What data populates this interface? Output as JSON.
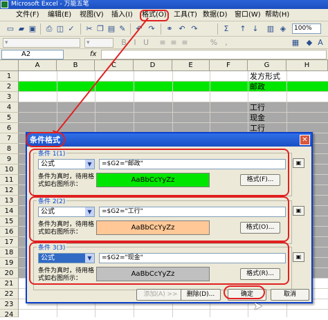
{
  "window": {
    "title": "Microsoft Excel - 万能五笔"
  },
  "menu": [
    "文件(F)",
    "编辑(E)",
    "视图(V)",
    "插入(I)",
    "格式(O)",
    "工具(T)",
    "数据(D)",
    "窗口(W)",
    "帮助(H)"
  ],
  "toolbar": {
    "zoom": "100%"
  },
  "formula_bar": {
    "name_box": "A2",
    "fx_label": "fx"
  },
  "grid": {
    "columns": [
      "A",
      "B",
      "C",
      "D",
      "E",
      "F",
      "G",
      "H"
    ],
    "rows": [
      "1",
      "2",
      "3",
      "4",
      "5",
      "6",
      "7",
      "8",
      "9",
      "10",
      "11",
      "12",
      "13",
      "14",
      "15",
      "16",
      "17",
      "18",
      "19",
      "20",
      "21",
      "22",
      "23",
      "24"
    ],
    "g_cells": {
      "g1": "发方形式",
      "g2": "邮政",
      "g4": "工行",
      "g5": "现金",
      "g6": "工行"
    }
  },
  "dialog": {
    "title": "条件格式",
    "conditions": [
      {
        "label": "条件 1(1)",
        "type": "公式",
        "expression": "=$G2=\"邮政\"",
        "note": "条件为真时，待用格式如右图所示：",
        "preview": "AaBbCcYyZz",
        "format_button": "格式(F)...",
        "color": "#00e600"
      },
      {
        "label": "条件 2(2)",
        "type": "公式",
        "expression": "=$G2=\"工行\"",
        "note": "条件为真时，待用格式如右图所示：",
        "preview": "AaBbCcYyZz",
        "format_button": "格式(O)...",
        "color": "#ffc896"
      },
      {
        "label": "条件 3(3)",
        "type": "公式",
        "expression": "=$G2=\"现金\"",
        "note": "条件为真时，待用格式如右图所示：",
        "preview": "AaBbCcYyZz",
        "format_button": "格式(R)...",
        "color": "#c0c0c0"
      }
    ],
    "buttons": {
      "add": "添加(A) >>",
      "delete": "删除(D)...",
      "ok": "确定",
      "cancel": "取消"
    }
  },
  "colors": {
    "green_row": "#00e600",
    "gray_row": "#a8a8a8",
    "peach": "#ffc896"
  }
}
